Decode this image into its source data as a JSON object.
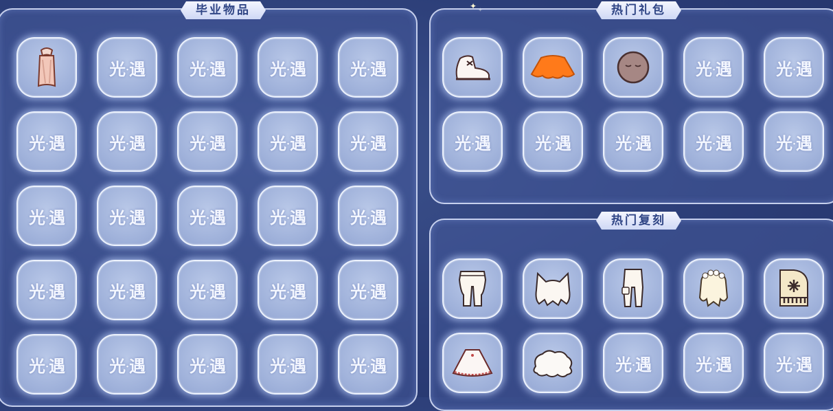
{
  "panels": {
    "graduation": {
      "title": "毕业物品"
    },
    "hot_gifts": {
      "title": "热门礼包"
    },
    "hot_reruns": {
      "title": "热门复刻"
    }
  },
  "placeholder_logo": {
    "left": "光",
    "dot": "·",
    "right": "遇"
  },
  "graduation_items": [
    {
      "icon": "scarf-cape-icon"
    },
    {
      "icon": "placeholder"
    },
    {
      "icon": "placeholder"
    },
    {
      "icon": "placeholder"
    },
    {
      "icon": "placeholder"
    },
    {
      "icon": "placeholder"
    },
    {
      "icon": "placeholder"
    },
    {
      "icon": "placeholder"
    },
    {
      "icon": "placeholder"
    },
    {
      "icon": "placeholder"
    },
    {
      "icon": "placeholder"
    },
    {
      "icon": "placeholder"
    },
    {
      "icon": "placeholder"
    },
    {
      "icon": "placeholder"
    },
    {
      "icon": "placeholder"
    },
    {
      "icon": "placeholder"
    },
    {
      "icon": "placeholder"
    },
    {
      "icon": "placeholder"
    },
    {
      "icon": "placeholder"
    },
    {
      "icon": "placeholder"
    },
    {
      "icon": "placeholder"
    },
    {
      "icon": "placeholder"
    },
    {
      "icon": "placeholder"
    },
    {
      "icon": "placeholder"
    },
    {
      "icon": "placeholder"
    }
  ],
  "hot_gift_items": [
    {
      "icon": "shoe-icon"
    },
    {
      "icon": "orange-cape-icon"
    },
    {
      "icon": "mask-icon"
    },
    {
      "icon": "placeholder"
    },
    {
      "icon": "placeholder"
    },
    {
      "icon": "placeholder"
    },
    {
      "icon": "placeholder"
    },
    {
      "icon": "placeholder"
    },
    {
      "icon": "placeholder"
    },
    {
      "icon": "placeholder"
    }
  ],
  "hot_rerun_items": [
    {
      "icon": "pants-icon"
    },
    {
      "icon": "cat-ears-hair-icon"
    },
    {
      "icon": "trousers-icon"
    },
    {
      "icon": "flower-hair-icon"
    },
    {
      "icon": "piano-icon"
    },
    {
      "icon": "poncho-cape-icon"
    },
    {
      "icon": "curly-hair-icon"
    },
    {
      "icon": "placeholder"
    },
    {
      "icon": "placeholder"
    },
    {
      "icon": "placeholder"
    }
  ],
  "colors": {
    "background": "#2c3e78",
    "panel_border": "#e1e8ff",
    "title_text": "#2f4585",
    "slot_fill": "#a9bade"
  }
}
